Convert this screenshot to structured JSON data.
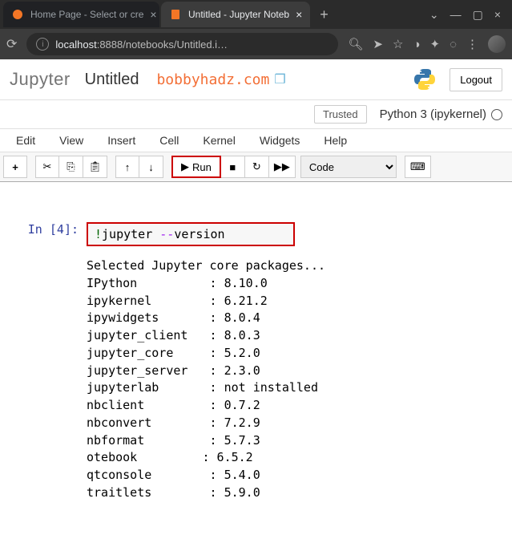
{
  "browser": {
    "tabs": [
      {
        "title": "Home Page - Select or cre",
        "active": false
      },
      {
        "title": "Untitled - Jupyter Noteb",
        "active": true
      }
    ],
    "url_host": "localhost",
    "url_port": ":8888",
    "url_path": "/notebooks/Untitled.i…"
  },
  "header": {
    "logo": "Jupyter",
    "notebook_name": "Untitled",
    "branding": "bobbyhadz.com",
    "logout": "Logout"
  },
  "subheader": {
    "trusted": "Trusted",
    "kernel": "Python 3 (ipykernel)"
  },
  "menu": {
    "edit": "Edit",
    "view": "View",
    "insert": "Insert",
    "cell": "Cell",
    "kernel": "Kernel",
    "widgets": "Widgets",
    "help": "Help"
  },
  "toolbar": {
    "run": "Run",
    "celltype": "Code"
  },
  "cell": {
    "prompt_prefix": "In [",
    "prompt_num": "4",
    "prompt_suffix": "]:",
    "code_bang": "!",
    "code_cmd": "jupyter ",
    "code_dashes": "--",
    "code_arg": "version"
  },
  "output_text": "Selected Jupyter core packages...\nIPython          : 8.10.0\nipykernel        : 6.21.2\nipywidgets       : 8.0.4\njupyter_client   : 8.0.3\njupyter_core     : 5.2.0\njupyter_server   : 2.3.0\njupyterlab       : not installed\nnbclient         : 0.7.2\nnbconvert        : 7.2.9\nnbformat         : 5.7.3\notebook         : 6.5.2\nqtconsole        : 5.4.0\ntraitlets        : 5.9.0"
}
